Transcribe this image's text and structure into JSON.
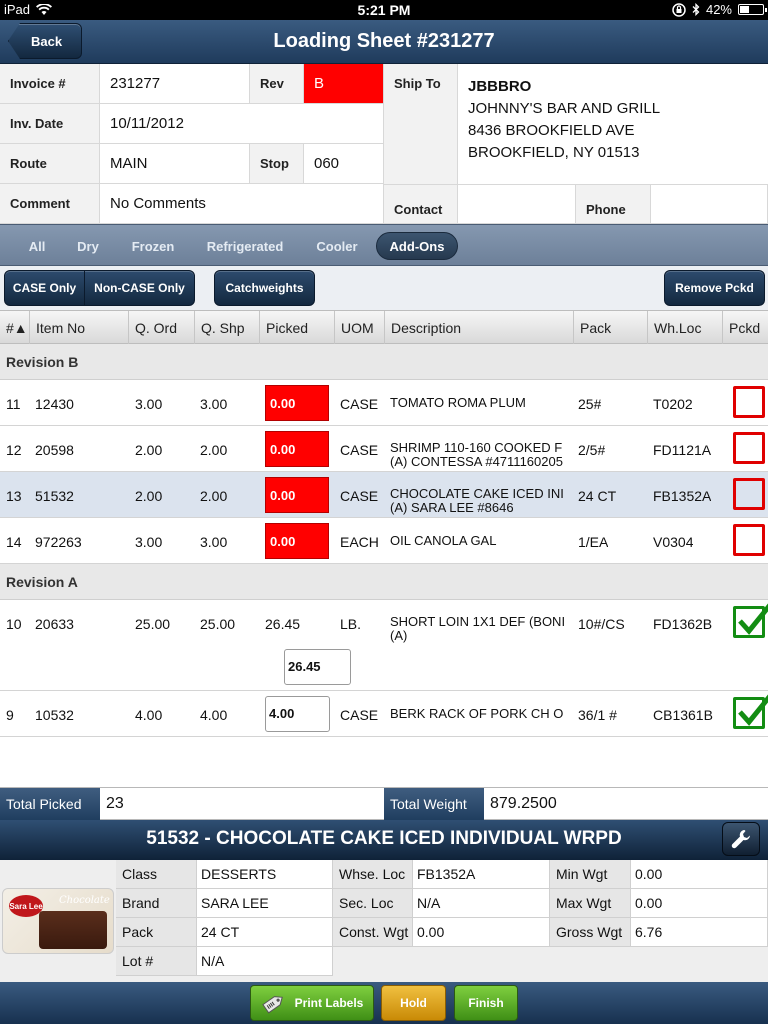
{
  "status_bar": {
    "device": "iPad",
    "time": "5:21 PM",
    "battery": "42%",
    "battery_level": 0.42
  },
  "nav": {
    "back_label": "Back",
    "title": "Loading Sheet #231277"
  },
  "header": {
    "invoice_label": "Invoice #",
    "invoice_value": "231277",
    "rev_label": "Rev",
    "rev_value": "B",
    "invdate_label": "Inv. Date",
    "invdate_value": "10/11/2012",
    "route_label": "Route",
    "route_value": "MAIN",
    "stop_label": "Stop",
    "stop_value": "060",
    "comment_label": "Comment",
    "comment_value": "No Comments",
    "shipto_label": "Ship To",
    "shipto_lines": [
      "JBBBRO",
      "JOHNNY'S BAR AND GRILL",
      "8436 BROOKFIELD AVE",
      "BROOKFIELD, NY 01513"
    ],
    "contact_label": "Contact",
    "contact_value": "",
    "phone_label": "Phone",
    "phone_value": ""
  },
  "filters": [
    "All",
    "Dry",
    "Frozen",
    "Refrigerated",
    "Cooler",
    "Add-Ons"
  ],
  "filter_active": "Add-Ons",
  "buttons": {
    "case_only": "CASE Only",
    "non_case_only": "Non-CASE Only",
    "catchweights": "Catchweights",
    "remove_pckd": "Remove Pckd"
  },
  "columns": [
    "#▲",
    "Item No",
    "Q. Ord",
    "Q. Shp",
    "Picked",
    "UOM",
    "Description",
    "Pack",
    "Wh.Loc",
    "Pckd"
  ],
  "sections": [
    {
      "title": "Revision B",
      "rows": [
        {
          "num": "11",
          "item": "12430",
          "qord": "3.00",
          "qshp": "3.00",
          "picked": "0.00",
          "uom": "CASE",
          "desc1": "TOMATO ROMA PLUM",
          "desc2": "",
          "pack": "25#",
          "whloc": "T0202",
          "pckd": false
        },
        {
          "num": "12",
          "item": "20598",
          "qord": "2.00",
          "qshp": "2.00",
          "picked": "0.00",
          "uom": "CASE",
          "desc1": "SHRIMP 110-160 COOKED F",
          "desc2": "(A) CONTESSA #4711160205",
          "pack": "2/5#",
          "whloc": "FD1121A",
          "pckd": false
        },
        {
          "num": "13",
          "item": "51532",
          "qord": "2.00",
          "qshp": "2.00",
          "picked": "0.00",
          "uom": "CASE",
          "desc1": "CHOCOLATE CAKE ICED INI",
          "desc2": "(A) SARA LEE #8646",
          "pack": "24 CT",
          "whloc": "FB1352A",
          "pckd": false
        },
        {
          "num": "14",
          "item": "972263",
          "qord": "3.00",
          "qshp": "3.00",
          "picked": "0.00",
          "uom": "EACH",
          "desc1": "OIL CANOLA GAL",
          "desc2": "",
          "pack": "1/EA",
          "whloc": "V0304",
          "pckd": false
        }
      ]
    },
    {
      "title": "Revision A",
      "rows": [
        {
          "num": "10",
          "item": "20633",
          "qord": "25.00",
          "qshp": "25.00",
          "picked": "26.45",
          "weight": "26.45",
          "uom": "LB.",
          "desc1": "SHORT LOIN 1X1 DEF (BONI",
          "desc2": "(A)",
          "pack": "10#/CS",
          "whloc": "FD1362B",
          "pckd": true
        },
        {
          "num": "9",
          "item": "10532",
          "qord": "4.00",
          "qshp": "4.00",
          "picked": "4.00",
          "uom": "CASE",
          "desc1": "BERK RACK OF PORK CH O",
          "desc2": "",
          "pack": "36/1 #",
          "whloc": "CB1361B",
          "pckd": true
        }
      ]
    }
  ],
  "totals": {
    "picked_label": "Total Picked",
    "picked_value": "23",
    "weight_label": "Total Weight",
    "weight_value": "879.2500"
  },
  "detail": {
    "title": "51532 - CHOCOLATE CAKE ICED INDIVIDUAL WRPD",
    "image_alt": "Sara Lee Chocolate Cake",
    "image_logo": "Sara Lee",
    "image_script": "Chocolate Cake",
    "class_label": "Class",
    "class_value": "DESSERTS",
    "brand_label": "Brand",
    "brand_value": "SARA LEE",
    "pack_label": "Pack",
    "pack_value": "24 CT",
    "lot_label": "Lot #",
    "lot_value": "N/A",
    "whse_label": "Whse. Loc",
    "whse_value": "FB1352A",
    "sec_label": "Sec. Loc",
    "sec_value": "N/A",
    "const_label": "Const. Wgt",
    "const_value": "0.00",
    "min_label": "Min Wgt",
    "min_value": "0.00",
    "max_label": "Max Wgt",
    "max_value": "0.00",
    "gross_label": "Gross Wgt",
    "gross_value": "6.76"
  },
  "bottom": {
    "print_labels": "Print Labels",
    "hold": "Hold",
    "finish": "Finish"
  },
  "colors": {
    "nav": "#1f3b5c",
    "alert_red": "#ff0000",
    "check_green": "#138d13",
    "selected_row": "#dbe3ee"
  }
}
